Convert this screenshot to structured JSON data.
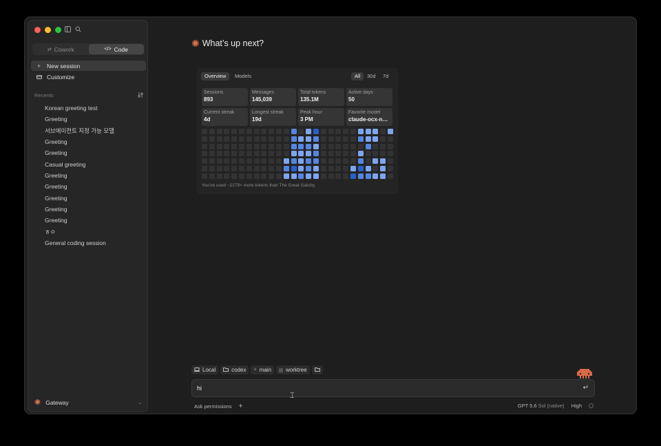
{
  "sidebar": {
    "modes": [
      {
        "label": "Cowork",
        "icon": "cowork-icon",
        "active": false
      },
      {
        "label": "Code",
        "icon": "code-icon",
        "active": true
      }
    ],
    "nav": [
      {
        "label": "New session",
        "icon": "plus-icon",
        "active": true
      },
      {
        "label": "Customize",
        "icon": "briefcase-icon",
        "active": false
      }
    ],
    "recents_label": "Recents",
    "recents": [
      "Korean greeting test",
      "Greeting",
      "서브에이전트 지정 가능 모델",
      "Greeting",
      "Greeting",
      "Casual greeting",
      "Greeting",
      "Greeting",
      "Greeting",
      "Greeting",
      "Greeting",
      "ㅎㅇ",
      "General coding session"
    ],
    "footer": {
      "label": "Gateway"
    }
  },
  "main": {
    "title": "What’s up next?"
  },
  "stats": {
    "tabs": [
      "Overview",
      "Models"
    ],
    "active_tab": "Overview",
    "ranges": [
      "All",
      "30d",
      "7d"
    ],
    "active_range": "All",
    "cards": [
      {
        "label": "Sessions",
        "value": "893"
      },
      {
        "label": "Messages",
        "value": "145,039"
      },
      {
        "label": "Total tokens",
        "value": "135.1M"
      },
      {
        "label": "Active days",
        "value": "50"
      },
      {
        "label": "Current streak",
        "value": "4d"
      },
      {
        "label": "Longest streak",
        "value": "19d"
      },
      {
        "label": "Peak hour",
        "value": "3 PM"
      },
      {
        "label": "Favorite model",
        "value": "claude-ocx-nati..."
      }
    ],
    "heatmap": {
      "columns": 26,
      "rows": 7,
      "colors": {
        "0": "#333333",
        "1": "#7ea6ee",
        "2": "#5585e0",
        "3": "#2a5fcb"
      },
      "levels": [
        [
          0,
          0,
          0,
          0,
          0,
          0,
          0,
          0,
          0,
          0,
          0,
          0,
          2,
          0,
          1,
          3,
          0,
          0,
          0,
          0,
          0,
          1,
          1,
          1,
          0,
          1
        ],
        [
          0,
          0,
          0,
          0,
          0,
          0,
          0,
          0,
          0,
          0,
          0,
          0,
          2,
          1,
          1,
          2,
          0,
          0,
          0,
          0,
          0,
          2,
          1,
          1,
          0,
          0
        ],
        [
          0,
          0,
          0,
          0,
          0,
          0,
          0,
          0,
          0,
          0,
          0,
          0,
          2,
          2,
          2,
          1,
          0,
          0,
          0,
          0,
          0,
          0,
          2,
          0,
          0,
          0
        ],
        [
          0,
          0,
          0,
          0,
          0,
          0,
          0,
          0,
          0,
          0,
          0,
          0,
          1,
          1,
          1,
          2,
          0,
          0,
          0,
          0,
          0,
          1,
          0,
          0,
          0,
          0
        ],
        [
          0,
          0,
          0,
          0,
          0,
          0,
          0,
          0,
          0,
          0,
          0,
          1,
          2,
          1,
          2,
          2,
          0,
          0,
          0,
          0,
          0,
          2,
          0,
          1,
          1,
          0
        ],
        [
          0,
          0,
          0,
          0,
          0,
          0,
          0,
          0,
          0,
          0,
          0,
          2,
          3,
          1,
          2,
          1,
          0,
          0,
          0,
          0,
          1,
          3,
          1,
          0,
          1,
          0
        ],
        [
          0,
          0,
          0,
          0,
          0,
          0,
          0,
          0,
          0,
          0,
          0,
          1,
          1,
          2,
          1,
          1,
          0,
          0,
          0,
          0,
          3,
          2,
          2,
          1,
          1,
          0
        ]
      ]
    },
    "footnote": "You've used ~2179× more tokens than The Great Gatsby."
  },
  "composer": {
    "chips": [
      {
        "label": "Local",
        "icon": "laptop-icon"
      },
      {
        "label": "codex",
        "icon": "folder-icon"
      },
      {
        "label": "main",
        "icon": "branch-icon"
      },
      {
        "label": "worktree",
        "icon": "worktree-icon"
      },
      {
        "label": "",
        "icon": "folder-icon"
      }
    ],
    "input_value": "hi",
    "permissions_label": "Ask permissions",
    "model_label": "GPT 5.6",
    "model_sub": "Sol (native)",
    "effort_label": "High"
  }
}
